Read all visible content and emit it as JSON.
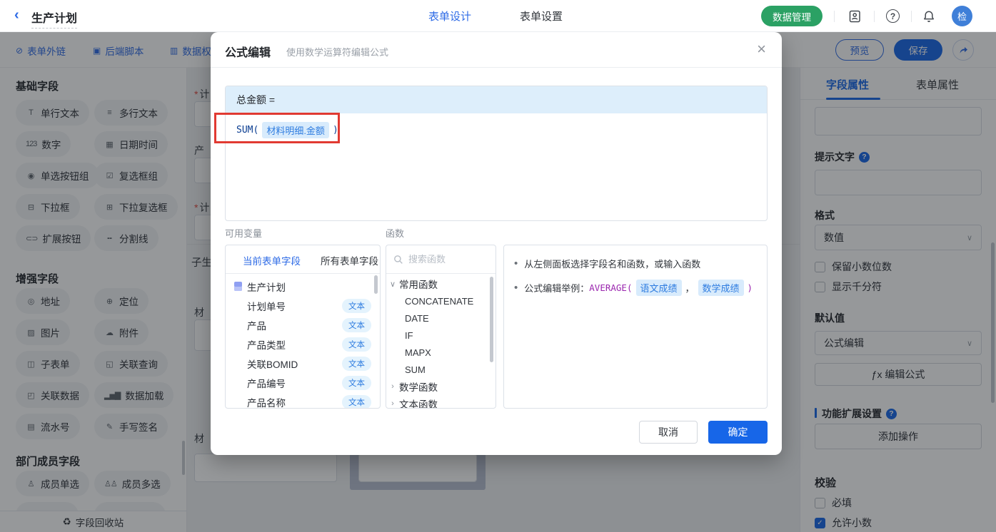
{
  "colors": {
    "primary": "#1766e8",
    "link_blue": "#2e6be6",
    "green": "#2ba164",
    "annotation_red": "#e13a32",
    "chip_bg": "#d8ebfc",
    "chip_text": "#2e7ce0",
    "example_purple": "#9b27af"
  },
  "topbar": {
    "back_glyph": "‹",
    "title": "生产计划",
    "tab_design": "表单设计",
    "tab_settings": "表单设置",
    "data_manage": "数据管理",
    "help_glyph": "?",
    "avatar": "检"
  },
  "subbar": {
    "links": [
      {
        "glyph": "⊘",
        "label": "表单外链"
      },
      {
        "glyph": "▣",
        "label": "后端脚本"
      },
      {
        "glyph": "▥",
        "label": "数据权"
      }
    ],
    "preview": "预览",
    "save": "保存"
  },
  "left_sidebar": {
    "sections": [
      {
        "title": "基础字段",
        "items": [
          {
            "glyph": "T",
            "label": "单行文本"
          },
          {
            "glyph": "≡",
            "label": "多行文本"
          },
          {
            "glyph": "123",
            "label": "数字"
          },
          {
            "glyph": "▦",
            "label": "日期时间"
          },
          {
            "glyph": "◉",
            "label": "单选按钮组"
          },
          {
            "glyph": "☑",
            "label": "复选框组"
          },
          {
            "glyph": "⊟",
            "label": "下拉框"
          },
          {
            "glyph": "⊞",
            "label": "下拉复选框"
          },
          {
            "glyph": "⊂⊃",
            "label": "扩展按钮"
          },
          {
            "glyph": "╍",
            "label": "分割线"
          }
        ]
      },
      {
        "title": "增强字段",
        "items": [
          {
            "glyph": "◎",
            "label": "地址"
          },
          {
            "glyph": "⊕",
            "label": "定位"
          },
          {
            "glyph": "▨",
            "label": "图片"
          },
          {
            "glyph": "☁",
            "label": "附件"
          },
          {
            "glyph": "◫",
            "label": "子表单"
          },
          {
            "glyph": "◱",
            "label": "关联查询"
          },
          {
            "glyph": "◰",
            "label": "关联数据"
          },
          {
            "glyph": "▂▅▇",
            "label": "数据加载"
          },
          {
            "glyph": "▤",
            "label": "流水号"
          },
          {
            "glyph": "✎",
            "label": "手写签名"
          }
        ]
      },
      {
        "title": "部门成员字段",
        "items": [
          {
            "glyph": "♙",
            "label": "成员单选"
          },
          {
            "glyph": "♙♙",
            "label": "成员多选"
          }
        ]
      }
    ],
    "recycle": {
      "glyph": "♻",
      "label": "字段回收站"
    }
  },
  "canvas": {
    "fragments": [
      {
        "star": "*",
        "text": "计"
      },
      {
        "star": "",
        "text": "产"
      },
      {
        "star": "*",
        "text": "计"
      },
      {
        "star": "",
        "text": "子生"
      },
      {
        "star": "",
        "text": "材"
      },
      {
        "star": "",
        "text": "材"
      }
    ]
  },
  "modal": {
    "title": "公式编辑",
    "subtitle": "使用数学运算符编辑公式",
    "close_glyph": "×",
    "target": "总金额 =",
    "formula": {
      "fn": "SUM(",
      "field": "材料明细.金额",
      "close": ")"
    },
    "variables": {
      "label": "可用变量",
      "tab_current": "当前表单字段",
      "tab_all": "所有表单字段",
      "root": "生产计划",
      "fields": [
        {
          "name": "计划单号",
          "type": "文本"
        },
        {
          "name": "产品",
          "type": "文本"
        },
        {
          "name": "产品类型",
          "type": "文本"
        },
        {
          "name": "关联BOMID",
          "type": "文本"
        },
        {
          "name": "产品编号",
          "type": "文本"
        },
        {
          "name": "产品名称",
          "type": "文本"
        }
      ]
    },
    "functions": {
      "label": "函数",
      "search_placeholder": "搜索函数",
      "chevron_open": "∨",
      "chevron_closed": "›",
      "group_common": "常用函数",
      "common_items": [
        "CONCATENATE",
        "DATE",
        "IF",
        "MAPX",
        "SUM"
      ],
      "group_math": "数学函数",
      "group_text": "文本函数"
    },
    "hints": {
      "bullet": "•",
      "line1": "从左侧面板选择字段名和函数，或输入函数",
      "example_prefix": "公式编辑举例：",
      "example_fn": "AVERAGE(",
      "chip1": "语文成绩",
      "comma": "，",
      "chip2": "数学成绩",
      "close": ")"
    },
    "cancel": "取消",
    "confirm": "确定"
  },
  "right_sidebar": {
    "tab_field": "字段属性",
    "tab_form": "表单属性",
    "hint_label": "提示文字",
    "format_label": "格式",
    "format_value": "数值",
    "chevron": "∨",
    "cb_decimal": "保留小数位数",
    "cb_thousand": "显示千分符",
    "default_label": "默认值",
    "default_value": "公式编辑",
    "fx_button": "ƒx  编辑公式",
    "ext_label": "功能扩展设置",
    "add_action": "添加操作",
    "validate_label": "校验",
    "required": "必填",
    "allow_decimal": "允许小数",
    "check_glyph": "✓",
    "help_glyph": "?"
  }
}
